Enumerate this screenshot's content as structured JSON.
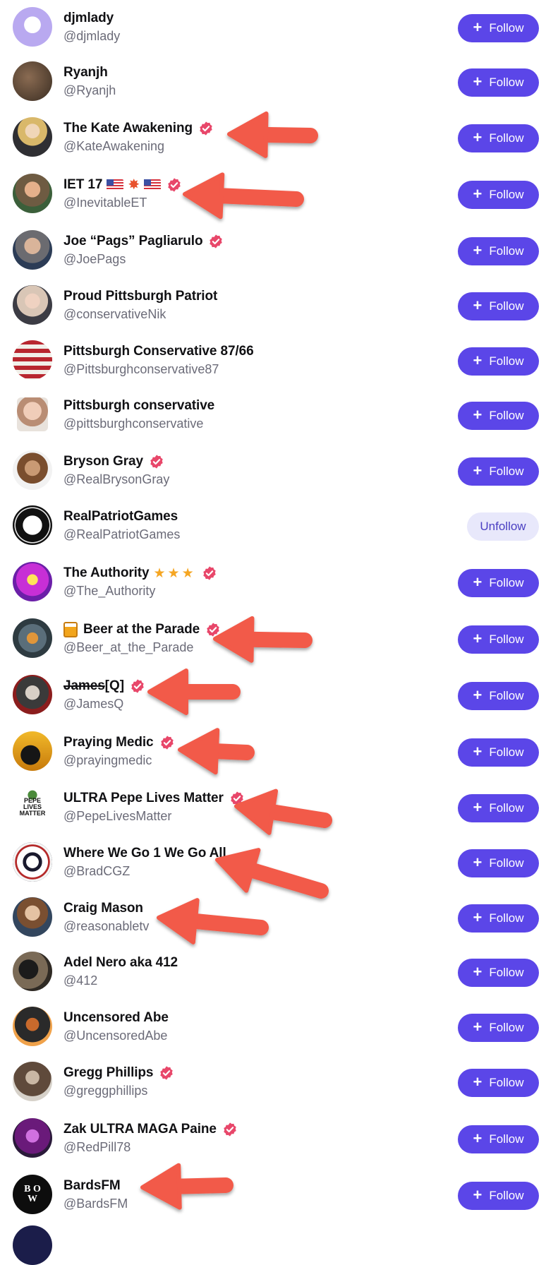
{
  "follow_label": "Follow",
  "unfollow_label": "Unfollow",
  "accounts": [
    {
      "name": "djmlady",
      "handle": "@djmlady",
      "verified": false,
      "button": "Follow",
      "avatar": "eagle-logo"
    },
    {
      "name": "Ryanjh",
      "handle": "@Ryanjh",
      "verified": false,
      "button": "Follow",
      "avatar": "photo"
    },
    {
      "name": "The Kate Awakening",
      "handle": "@KateAwakening",
      "verified": true,
      "button": "Follow",
      "avatar": "photo"
    },
    {
      "name": "IET 17",
      "handle": "@InevitableET",
      "verified": true,
      "button": "Follow",
      "avatar": "photo",
      "decoration": "flags-burst"
    },
    {
      "name": "Joe “Pags” Pagliarulo",
      "handle": "@JoePags",
      "verified": true,
      "button": "Follow",
      "avatar": "photo"
    },
    {
      "name": "Proud Pittsburgh Patriot",
      "handle": "@conservativeNik",
      "verified": false,
      "button": "Follow",
      "avatar": "photo"
    },
    {
      "name": "Pittsburgh Conservative 87/66",
      "handle": "@Pittsburghconservative87",
      "verified": false,
      "button": "Follow",
      "avatar": "flag"
    },
    {
      "name": "Pittsburgh conservative",
      "handle": "@pittsburghconservative",
      "verified": false,
      "button": "Follow",
      "avatar": "photo-square"
    },
    {
      "name": "Bryson Gray",
      "handle": "@RealBrysonGray",
      "verified": true,
      "button": "Follow",
      "avatar": "photo"
    },
    {
      "name": "RealPatriotGames",
      "handle": "@RealPatriotGames",
      "verified": false,
      "button": "Unfollow",
      "avatar": "logo-dark"
    },
    {
      "name": "The Authority",
      "handle": "@The_Authority",
      "verified": true,
      "button": "Follow",
      "avatar": "photo",
      "decoration": "stars"
    },
    {
      "name": "Beer at the Parade",
      "handle": "@Beer_at_the_Parade",
      "verified": true,
      "button": "Follow",
      "avatar": "photo",
      "decoration": "beer-mug"
    },
    {
      "name": "James",
      "name_suffix": "[Q]",
      "handle": "@JamesQ",
      "verified": true,
      "button": "Follow",
      "avatar": "photo"
    },
    {
      "name": "Praying Medic",
      "handle": "@prayingmedic",
      "verified": true,
      "button": "Follow",
      "avatar": "silhouette"
    },
    {
      "name": "ULTRA Pepe Lives Matter",
      "handle": "@PepeLivesMatter",
      "verified": true,
      "button": "Follow",
      "avatar": "pepe-logo",
      "avatar_text": "PEPE LIVES MATTER"
    },
    {
      "name": "Where We Go 1 We Go All",
      "handle": "@BradCGZ",
      "verified": false,
      "button": "Follow",
      "avatar": "q-logo"
    },
    {
      "name": "Craig Mason",
      "handle": "@reasonabletv",
      "verified": false,
      "button": "Follow",
      "avatar": "photo"
    },
    {
      "name": "Adel Nero aka 412",
      "handle": "@412",
      "verified": false,
      "button": "Follow",
      "avatar": "photo"
    },
    {
      "name": "Uncensored Abe",
      "handle": "@UncensoredAbe",
      "verified": false,
      "button": "Follow",
      "avatar": "photo"
    },
    {
      "name": "Gregg Phillips",
      "handle": "@greggphillips",
      "verified": true,
      "button": "Follow",
      "avatar": "photo"
    },
    {
      "name": "Zak ULTRA MAGA Paine",
      "handle": "@RedPill78",
      "verified": true,
      "button": "Follow",
      "avatar": "photo"
    },
    {
      "name": "BardsFM",
      "handle": "@BardsFM",
      "verified": false,
      "button": "Follow",
      "avatar": "bow-logo",
      "avatar_text": "B O W"
    }
  ],
  "colors": {
    "follow_bg": "#5b46e8",
    "unfollow_bg": "#e8e8fb",
    "verified": "#e8476a",
    "arrow": "#f25a4a"
  },
  "annotation_arrows_point_to": [
    "The Kate Awakening",
    "IET 17",
    "Beer at the Parade",
    "James[Q]",
    "Praying Medic",
    "ULTRA Pepe Lives Matter",
    "Where We Go 1 We Go All",
    "Craig Mason",
    "BardsFM"
  ]
}
